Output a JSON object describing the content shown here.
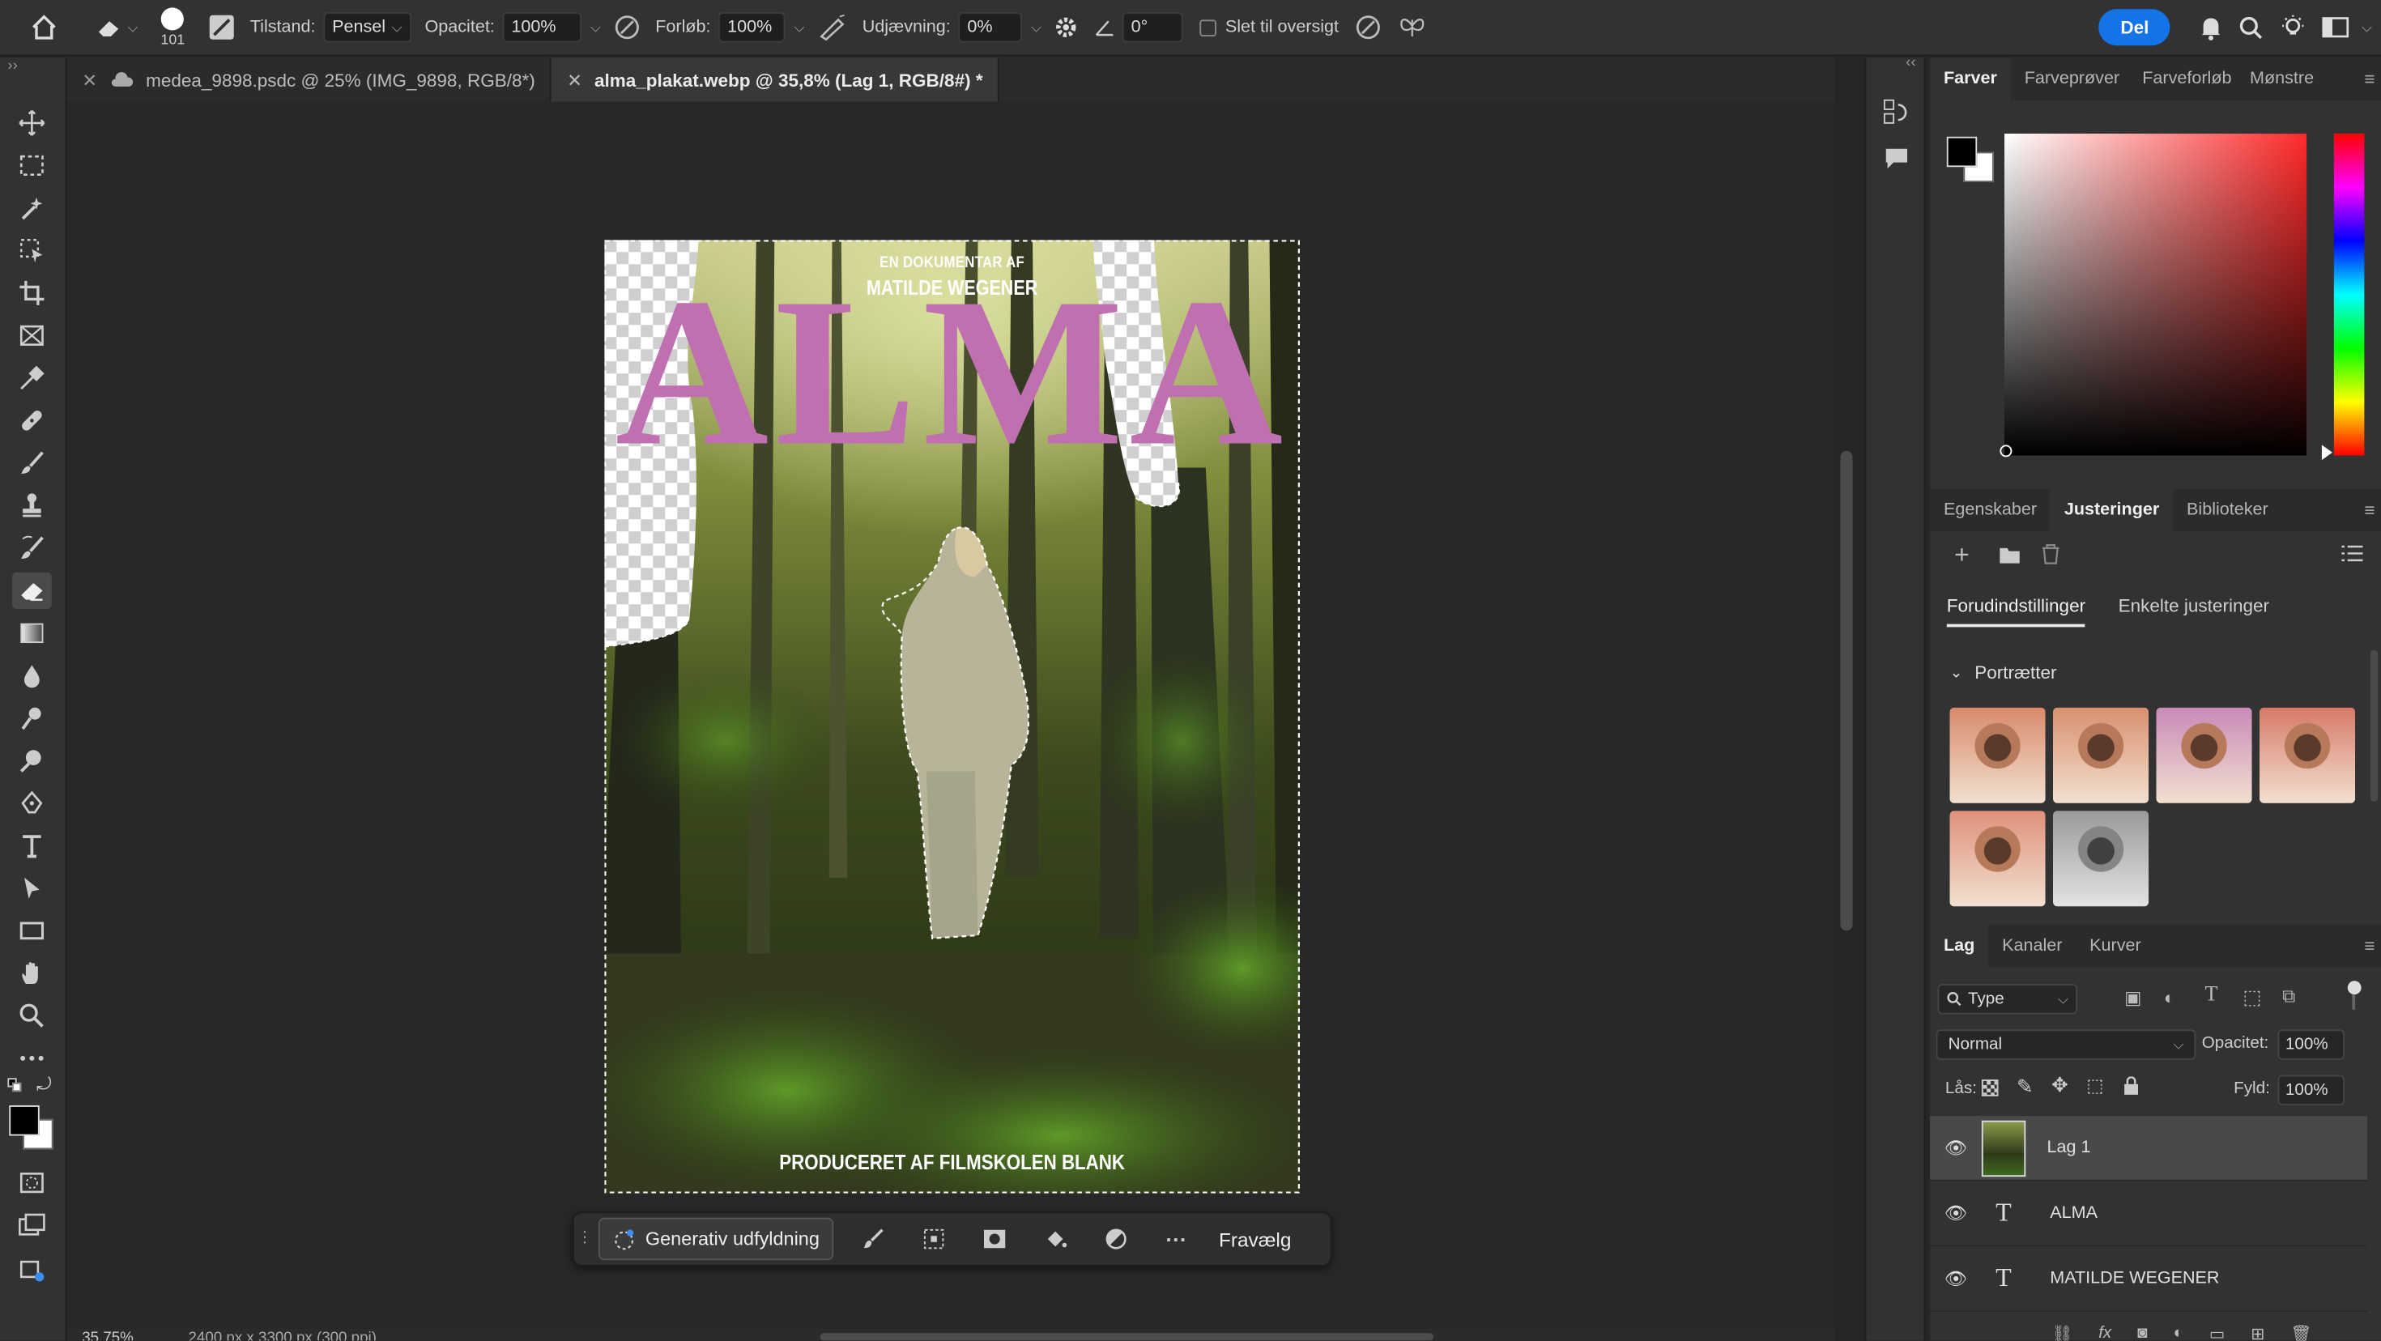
{
  "options_bar": {
    "brush_size": "101",
    "mode_label": "Tilstand:",
    "mode_value": "Pensel",
    "opacity_label": "Opacitet:",
    "opacity_value": "100%",
    "flow_label": "Forløb:",
    "flow_value": "100%",
    "smoothing_label": "Udjævning:",
    "smoothing_value": "0%",
    "angle_value": "0°",
    "erase_history_label": "Slet til oversigt",
    "share_label": "Del"
  },
  "tabs": [
    {
      "label": "medea_9898.psdc @ 25% (IMG_9898, RGB/8*)",
      "active": false
    },
    {
      "label": "alma_plakat.webp @ 35,8% (Lag 1, RGB/8#) *",
      "active": true
    }
  ],
  "poster": {
    "line1": "EN DOKUMENTAR AF",
    "line2": "MATILDE WEGENER",
    "title": "ALMA",
    "credit": "PRODUCERET AF FILMSKOLEN BLANK",
    "title_color": "#c06fb0"
  },
  "contextual_bar": {
    "generative_fill": "Generativ udfyldning",
    "deselect": "Fravælg"
  },
  "status": {
    "zoom": "35,75%",
    "dimensions": "2400 px x 3300 px (300 ppi)"
  },
  "color_panel": {
    "tabs": [
      "Farver",
      "Farveprøver",
      "Farveforløb",
      "Mønstre"
    ],
    "active": "Farver",
    "hue_color": "#ff2a2a"
  },
  "adjust_panel": {
    "tabs": [
      "Egenskaber",
      "Justeringer",
      "Biblioteker"
    ],
    "active": "Justeringer",
    "subtabs": [
      "Forudindstillinger",
      "Enkelte justeringer"
    ],
    "section": "Portrætter",
    "preset_count": 6
  },
  "layers_panel": {
    "tabs": [
      "Lag",
      "Kanaler",
      "Kurver"
    ],
    "active": "Lag",
    "filter": "Type",
    "blend": "Normal",
    "opacity_label": "Opacitet:",
    "opacity_value": "100%",
    "lock_label": "Lås:",
    "fill_label": "Fyld:",
    "fill_value": "100%",
    "layers": [
      {
        "name": "Lag 1",
        "kind": "image",
        "selected": true
      },
      {
        "name": "ALMA",
        "kind": "text",
        "selected": false
      },
      {
        "name": "MATILDE WEGENER",
        "kind": "text",
        "selected": false
      }
    ]
  }
}
